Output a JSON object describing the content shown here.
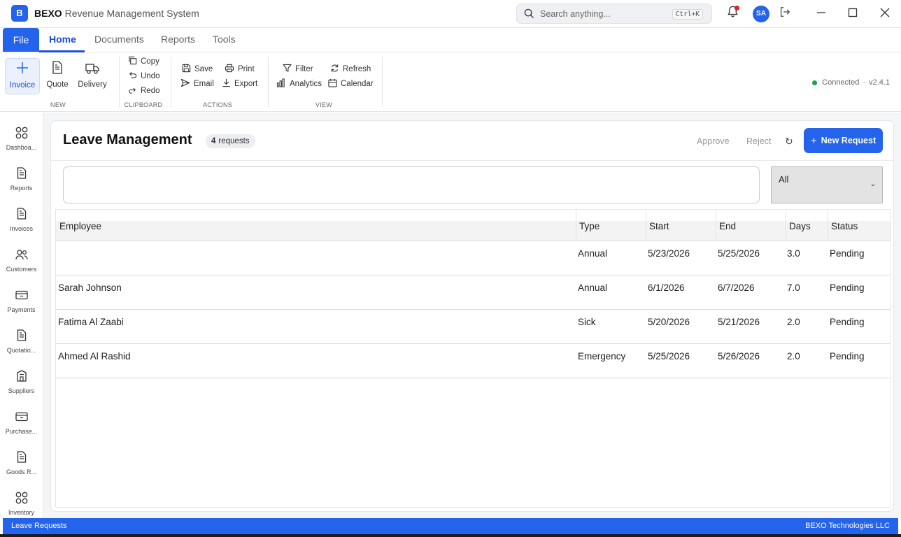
{
  "titlebar": {
    "brand": "BEXO",
    "subtitle": "Revenue Management System",
    "logo_letter": "B",
    "search_placeholder": "Search anything...",
    "search_shortcut": "Ctrl+K",
    "avatar_initials": "SA"
  },
  "menu": {
    "file": "File",
    "tabs": [
      "Home",
      "Documents",
      "Reports",
      "Tools"
    ]
  },
  "ribbon": {
    "new": {
      "label": "NEW",
      "invoice": "Invoice",
      "quote": "Quote",
      "delivery": "Delivery"
    },
    "clipboard": {
      "label": "CLIPBOARD",
      "copy": "Copy",
      "undo": "Undo",
      "redo": "Redo"
    },
    "actions": {
      "label": "ACTIONS",
      "save": "Save",
      "print": "Print",
      "email": "Email",
      "export": "Export"
    },
    "view": {
      "label": "VIEW",
      "filter": "Filter",
      "refresh": "Refresh",
      "analytics": "Analytics",
      "calendar": "Calendar"
    },
    "status": "Connected",
    "separator": "·",
    "version": "v2.4.1"
  },
  "sidebar": {
    "items": [
      "Dashboa...",
      "Reports",
      "Invoices",
      "Customers",
      "Payments",
      "Quotatio...",
      "Suppliers",
      "Purchase...",
      "Goods R...",
      "Inventory"
    ]
  },
  "page": {
    "title": "Leave Management",
    "count": "4",
    "count_label": "requests",
    "approve": "Approve",
    "reject": "Reject",
    "refresh_glyph": "↻",
    "new_request": "New Request",
    "search_value": "",
    "filter_value": "All"
  },
  "table": {
    "columns": [
      "Employee",
      "Type",
      "Start",
      "End",
      "Days",
      "Status"
    ],
    "rows": [
      {
        "employee": "",
        "type": "Annual",
        "start": "5/23/2026",
        "end": "5/25/2026",
        "days": "3.0",
        "status": "Pending"
      },
      {
        "employee": "Sarah Johnson",
        "type": "Annual",
        "start": "6/1/2026",
        "end": "6/7/2026",
        "days": "7.0",
        "status": "Pending"
      },
      {
        "employee": "Fatima Al Zaabi",
        "type": "Sick",
        "start": "5/20/2026",
        "end": "5/21/2026",
        "days": "2.0",
        "status": "Pending"
      },
      {
        "employee": "Ahmed Al Rashid",
        "type": "Emergency",
        "start": "5/25/2026",
        "end": "5/26/2026",
        "days": "2.0",
        "status": "Pending"
      }
    ]
  },
  "statusbar": {
    "left": "Leave Requests",
    "right": "BEXO Technologies LLC"
  },
  "colors": {
    "accent": "#2463eb",
    "notification": "#e11d2a",
    "connected": "#16a34a"
  }
}
